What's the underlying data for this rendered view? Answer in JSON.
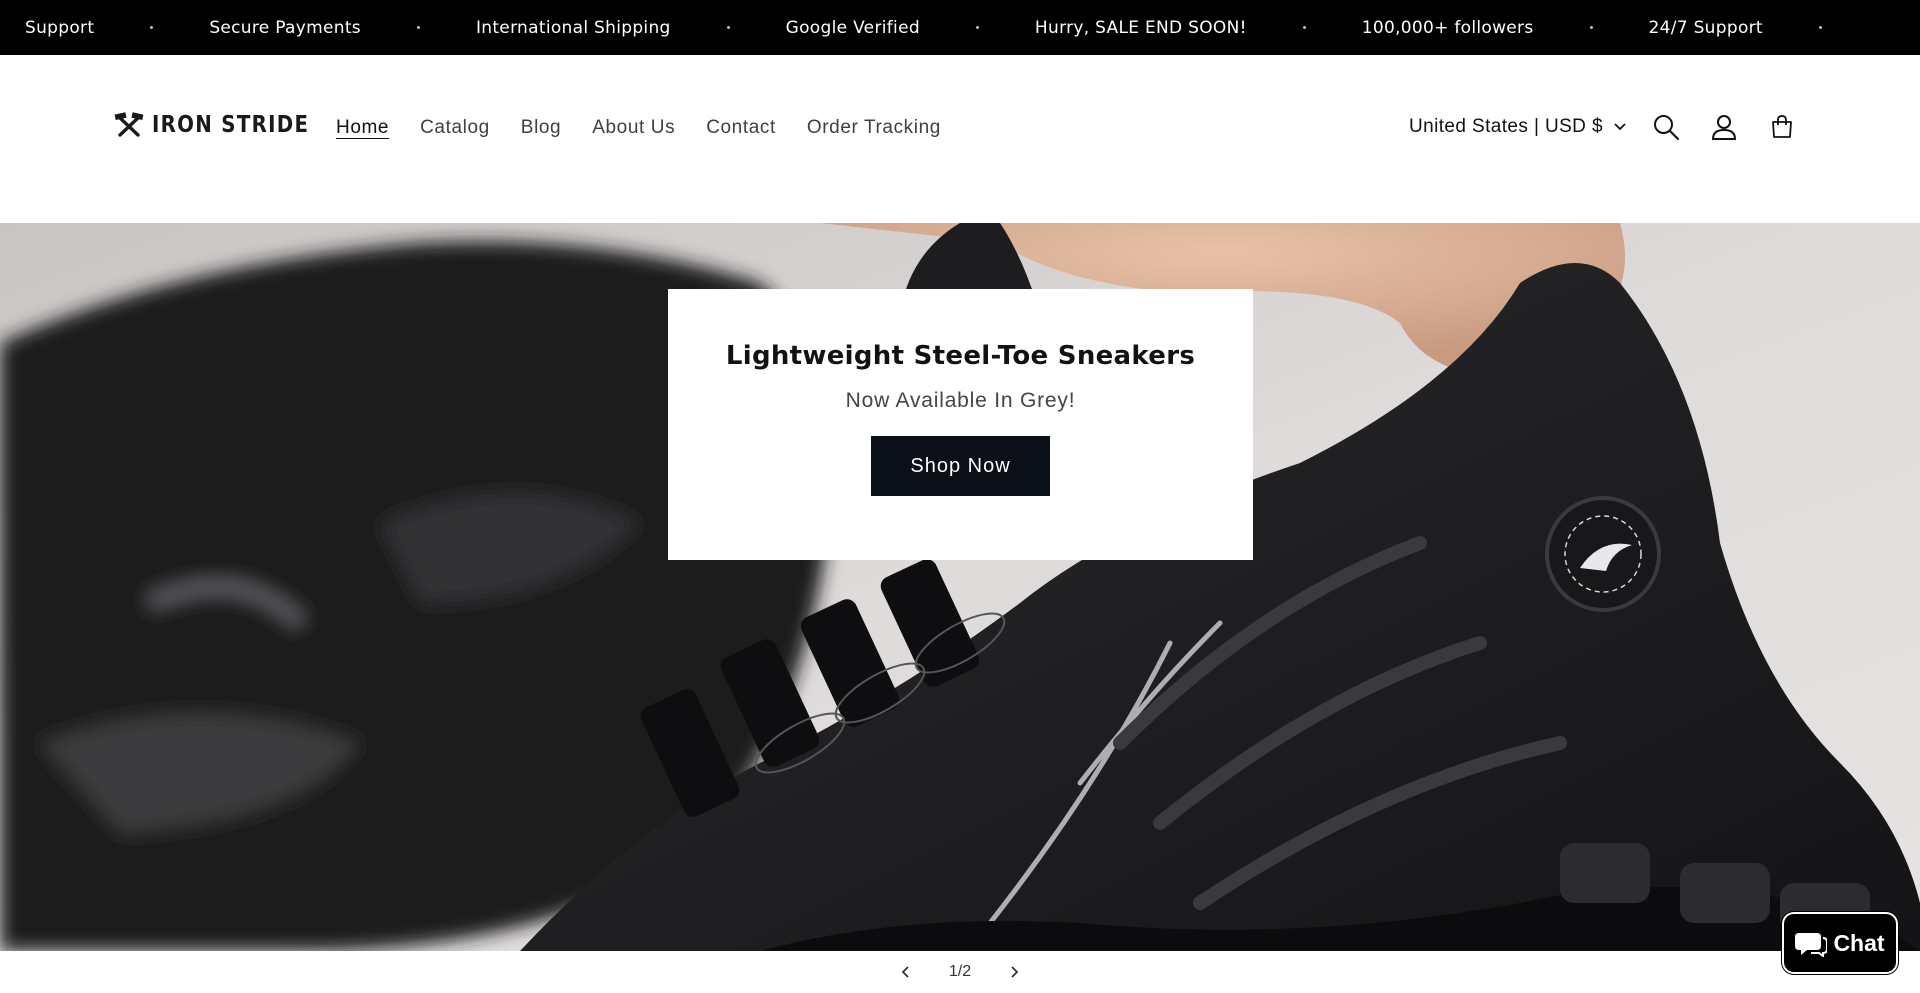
{
  "announcement": {
    "messages": [
      "Support",
      "Secure Payments",
      "International Shipping",
      "Google Verified",
      "Hurry, SALE END SOON!",
      "100,000+ followers",
      "24/7 Support"
    ]
  },
  "header": {
    "logo_text": "IRON STRIDE",
    "nav": [
      "Home",
      "Catalog",
      "Blog",
      "About Us",
      "Contact",
      "Order Tracking"
    ],
    "active_nav": "Home",
    "locale_label": "United States | USD $",
    "icons": [
      "search-icon",
      "account-icon",
      "cart-icon"
    ]
  },
  "hero": {
    "title": "Lightweight Steel-Toe Sneakers",
    "subtitle": "Now Available In Grey!",
    "button_label": "Shop Now"
  },
  "slider": {
    "counter": "1/2"
  },
  "chat": {
    "label": "Chat"
  },
  "colors": {
    "announcement_bg": "#000000",
    "button_bg": "#0b0f17",
    "page_bg": "#ffffff"
  }
}
